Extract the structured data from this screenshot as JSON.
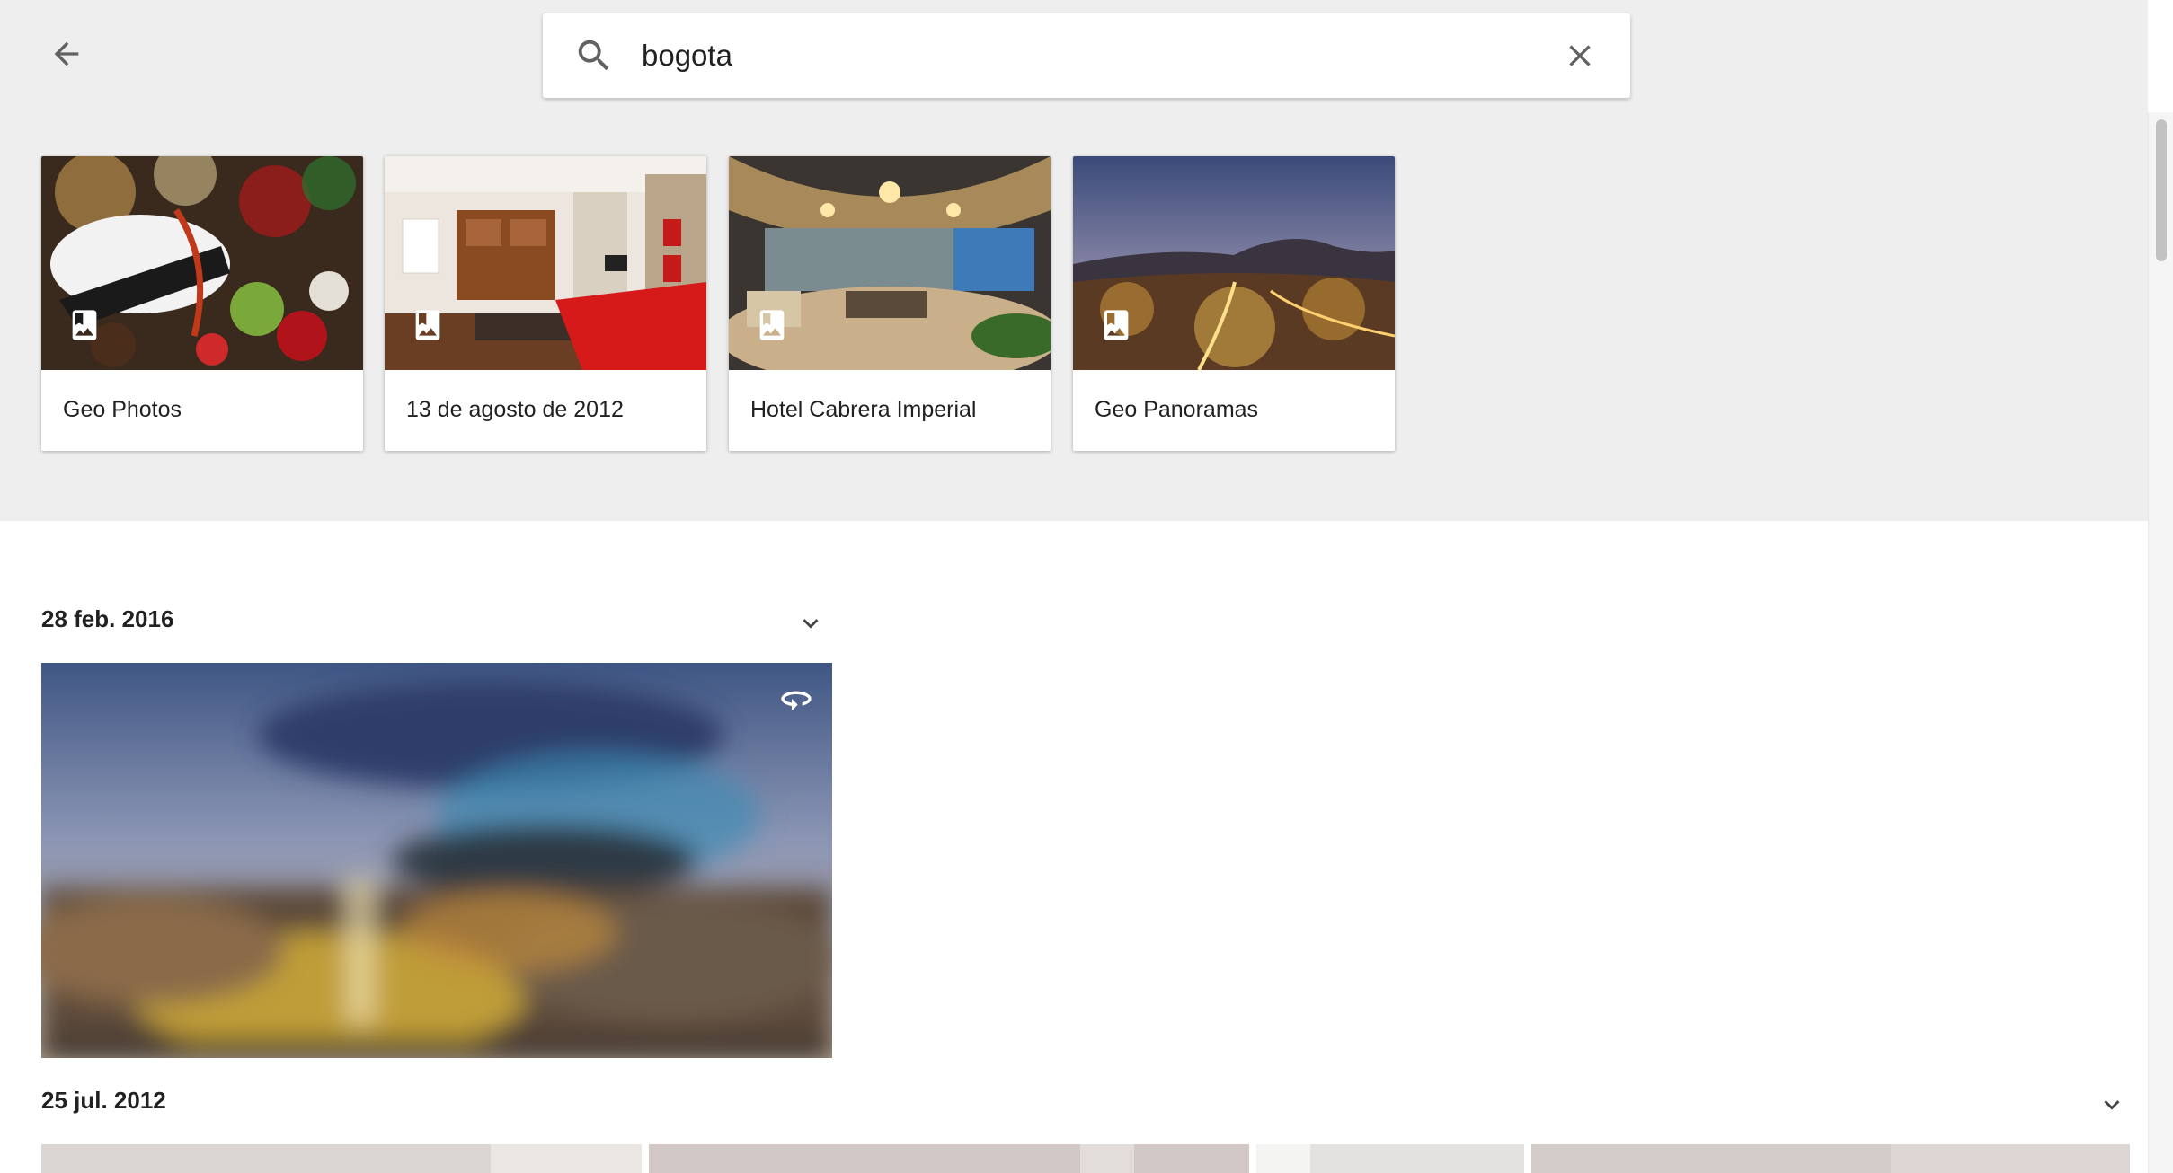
{
  "search": {
    "query": "bogota"
  },
  "albums": [
    {
      "label": "Geo Photos"
    },
    {
      "label": "13 de agosto de 2012"
    },
    {
      "label": "Hotel Cabrera Imperial"
    },
    {
      "label": "Geo Panoramas"
    }
  ],
  "sections": [
    {
      "date": "28 feb. 2016"
    },
    {
      "date": "25 jul. 2012"
    }
  ],
  "icons": {
    "back": "arrow-back-icon",
    "search": "search-icon",
    "clear": "close-icon",
    "album": "photo-album-icon",
    "expand": "chevron-down-icon",
    "panorama": "panorama-360-icon"
  },
  "colors": {
    "top_background": "#eeeeee",
    "text": "#212121",
    "icon": "#616161"
  }
}
